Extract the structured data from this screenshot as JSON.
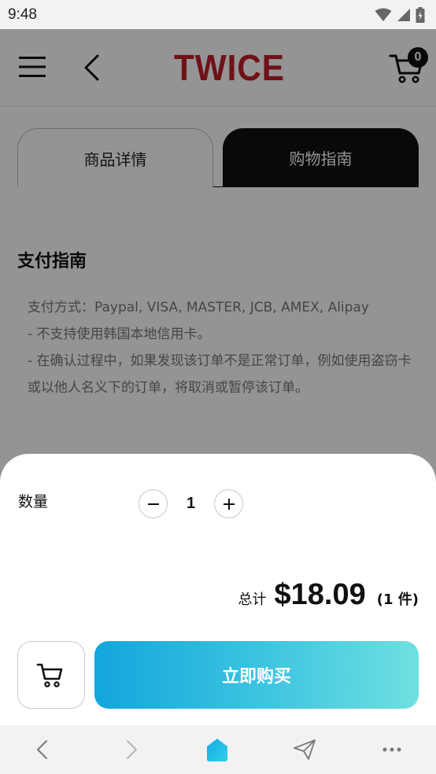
{
  "status_bar": {
    "time": "9:48"
  },
  "header": {
    "brand": "TWICE",
    "cart_count": "0"
  },
  "tabs": [
    {
      "label": "商品详情",
      "active": false
    },
    {
      "label": "购物指南",
      "active": true
    }
  ],
  "guide": {
    "title": "支付指南",
    "lines": [
      "支付方式：Paypal, VISA, MASTER, JCB, AMEX, Alipay",
      "- 不支持使用韩国本地信用卡。",
      "- 在确认过程中，如果发现该订单不是正常订单，例如使用盗窃卡或以他人名义下的订单，将取消或暂停该订单。"
    ]
  },
  "sheet": {
    "quantity_label": "数量",
    "quantity_value": "1",
    "total_label": "总计",
    "total_price": "$18.09",
    "total_count": "(1 件)",
    "buy_label": "立即购买"
  },
  "colors": {
    "brand": "#c0202a",
    "tab_active_bg": "#111111",
    "buy_gradient_start": "#13a6dc",
    "buy_gradient_end": "#6fe0e0",
    "home_icon": "#1fb6e6"
  },
  "icons": {
    "menu": "menu-icon",
    "back": "back-icon",
    "cart": "cart-icon",
    "minus": "minus-icon",
    "plus": "plus-icon",
    "nav_back": "chevron-left-icon",
    "nav_forward": "chevron-right-icon",
    "nav_home": "home-icon",
    "nav_share": "send-icon",
    "nav_more": "more-icon"
  }
}
